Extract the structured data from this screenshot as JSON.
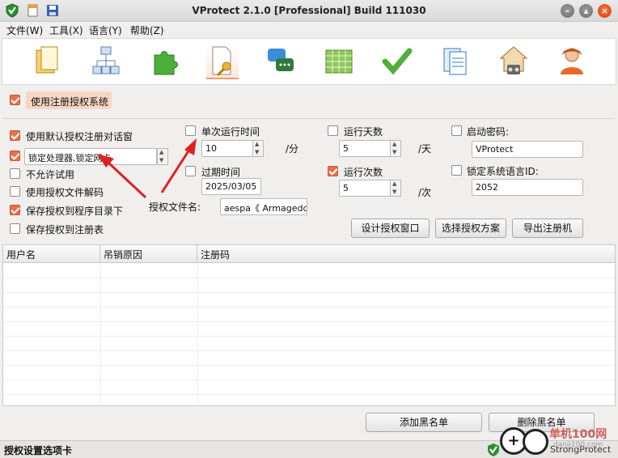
{
  "window": {
    "title": "VProtect 2.1.0 [Professional] Build 111030",
    "controls": [
      "minimize-icon",
      "maximize-icon",
      "close-icon"
    ]
  },
  "menu": [
    {
      "label": "文件(W)"
    },
    {
      "label": "工具(X)"
    },
    {
      "label": "语言(Y)"
    },
    {
      "label": "帮助(Z)"
    }
  ],
  "toolbar": {
    "items": [
      {
        "icon": "file-icon"
      },
      {
        "icon": "network-icon"
      },
      {
        "icon": "plugin-icon"
      },
      {
        "icon": "license-key-icon"
      },
      {
        "icon": "chat-icon"
      },
      {
        "icon": "spreadsheet-icon"
      },
      {
        "icon": "checkmark-icon"
      },
      {
        "icon": "document-stack-icon"
      },
      {
        "icon": "home-lock-icon"
      },
      {
        "icon": "user-icon"
      }
    ],
    "active_index": 3
  },
  "registration": {
    "enable_label": "使用注册授权系统",
    "enable_checked": true
  },
  "left_options": [
    {
      "label": "使用默认授权注册对话窗",
      "checked": true
    },
    {
      "label": "不允许试用",
      "checked": false
    },
    {
      "label": "使用授权文件解码",
      "checked": false
    },
    {
      "label": "保存授权到程序目录下",
      "checked": true
    },
    {
      "label": "保存授权到注册表",
      "checked": false
    }
  ],
  "lock_combo": {
    "checked": true,
    "value": "锁定处理器,锁定网卡"
  },
  "single_run": {
    "label": "单次运行时间",
    "checked": false,
    "value": "10",
    "unit": "/分"
  },
  "expire": {
    "label": "过期时间",
    "checked": false,
    "value": "2025/03/05"
  },
  "run_days": {
    "label": "运行天数",
    "checked": false,
    "value": "5",
    "unit": "/天"
  },
  "run_count": {
    "label": "运行次数",
    "checked": true,
    "value": "5",
    "unit": "/次"
  },
  "startup_password": {
    "label": "启动密码:",
    "checked": false,
    "value": "VProtect"
  },
  "lock_lang": {
    "label": "锁定系统语言ID:",
    "checked": false,
    "value": "2052"
  },
  "license_file": {
    "label": "授权文件名:",
    "value": "aespa《 Armageddo"
  },
  "buttons": {
    "design": "设计授权窗口",
    "choose": "选择授权方案",
    "export": "导出注册机",
    "add_blacklist": "添加黑名单",
    "delete_blacklist": "删除黑名单"
  },
  "table": {
    "columns": [
      "用户名",
      "吊销原因",
      "注册码"
    ],
    "rows": []
  },
  "status": {
    "left": "授权设置选项卡",
    "right": "StrongProtect",
    "watermark": "单机100网",
    "watermark_sub": "danji100.com"
  },
  "colors": {
    "accent": "#e8704d",
    "arrow": "#e02020",
    "highlight": "#f9d6c4"
  }
}
